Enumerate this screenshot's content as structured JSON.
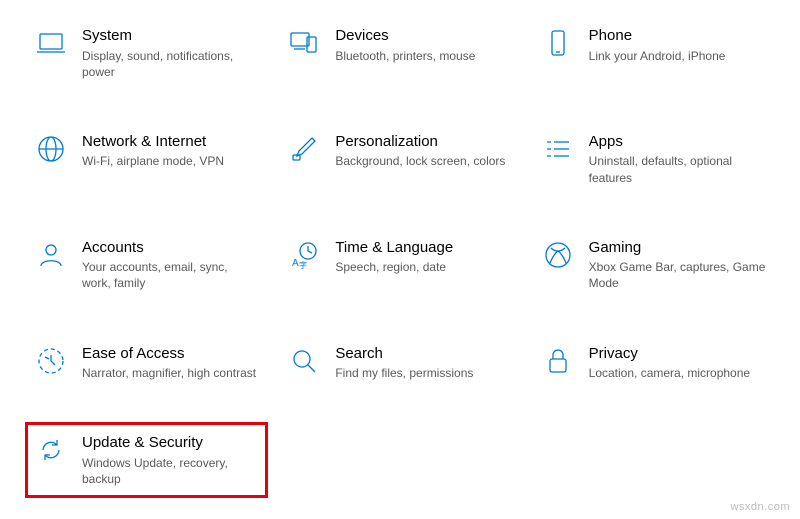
{
  "tiles": [
    {
      "id": "system",
      "title": "System",
      "desc": "Display, sound, notifications, power"
    },
    {
      "id": "devices",
      "title": "Devices",
      "desc": "Bluetooth, printers, mouse"
    },
    {
      "id": "phone",
      "title": "Phone",
      "desc": "Link your Android, iPhone"
    },
    {
      "id": "network",
      "title": "Network & Internet",
      "desc": "Wi-Fi, airplane mode, VPN"
    },
    {
      "id": "personalization",
      "title": "Personalization",
      "desc": "Background, lock screen, colors"
    },
    {
      "id": "apps",
      "title": "Apps",
      "desc": "Uninstall, defaults, optional features"
    },
    {
      "id": "accounts",
      "title": "Accounts",
      "desc": "Your accounts, email, sync, work, family"
    },
    {
      "id": "time",
      "title": "Time & Language",
      "desc": "Speech, region, date"
    },
    {
      "id": "gaming",
      "title": "Gaming",
      "desc": "Xbox Game Bar, captures, Game Mode"
    },
    {
      "id": "ease",
      "title": "Ease of Access",
      "desc": "Narrator, magnifier, high contrast"
    },
    {
      "id": "search",
      "title": "Search",
      "desc": "Find my files, permissions"
    },
    {
      "id": "privacy",
      "title": "Privacy",
      "desc": "Location, camera, microphone"
    },
    {
      "id": "update",
      "title": "Update & Security",
      "desc": "Windows Update, recovery, backup"
    }
  ],
  "watermark": "wsxdn.com",
  "highlighted": "update"
}
